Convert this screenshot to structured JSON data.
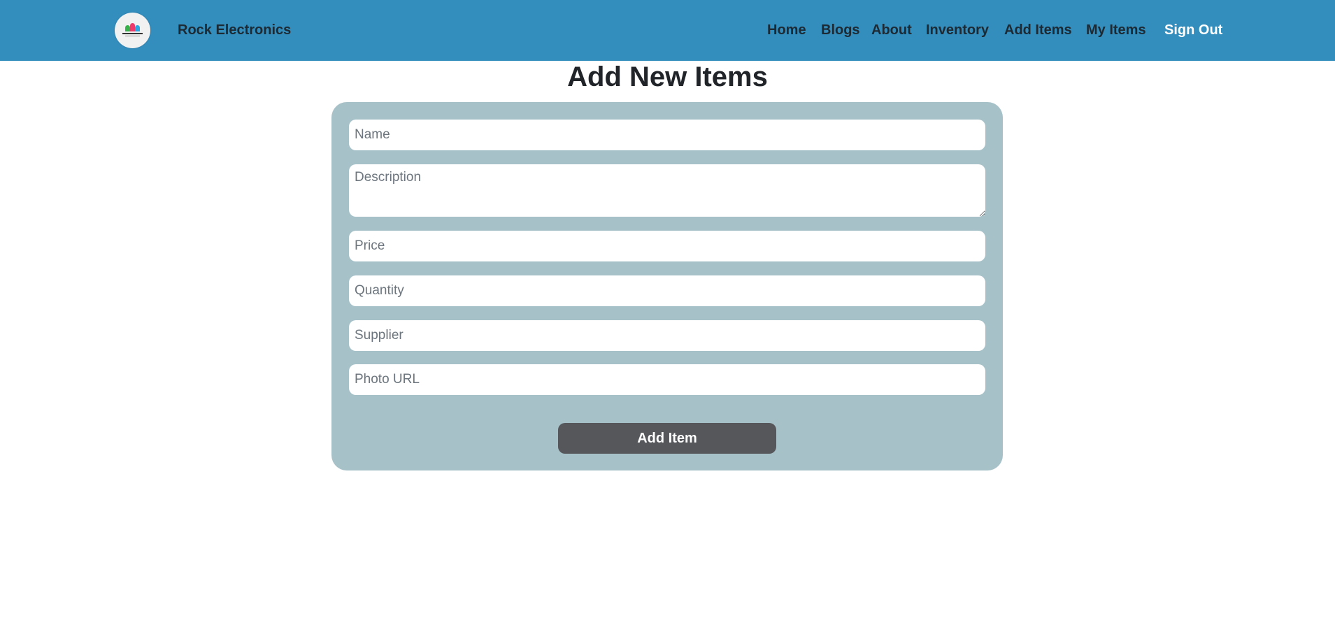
{
  "header": {
    "brand": "Rock Electronics",
    "logo_icon": "store-logo-icon",
    "background_color": "#338dbd",
    "nav": {
      "home": "Home",
      "blogs": "Blogs",
      "about": "About",
      "inventory": "Inventory",
      "add_items": "Add Items",
      "my_items": "My Items",
      "sign_out": "Sign Out"
    }
  },
  "main": {
    "title": "Add New Items",
    "card_color": "#a7c1c8",
    "form": {
      "name": {
        "value": "",
        "placeholder": "Name"
      },
      "description": {
        "value": "",
        "placeholder": "Description"
      },
      "price": {
        "value": "",
        "placeholder": "Price"
      },
      "quantity": {
        "value": "",
        "placeholder": "Quantity"
      },
      "supplier": {
        "value": "",
        "placeholder": "Supplier"
      },
      "photo_url": {
        "value": "",
        "placeholder": "Photo URL"
      },
      "submit_label": "Add Item",
      "submit_color": "#55575b"
    }
  }
}
